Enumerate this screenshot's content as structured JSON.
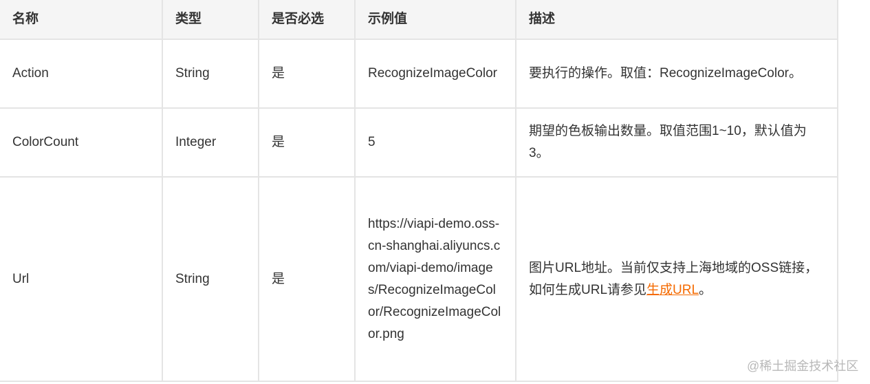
{
  "headers": [
    "名称",
    "类型",
    "是否必选",
    "示例值",
    "描述"
  ],
  "rows": [
    {
      "name": "Action",
      "type": "String",
      "required": "是",
      "example": "RecognizeImageColor",
      "desc": "要执行的操作。取值：RecognizeImageColor。"
    },
    {
      "name": "ColorCount",
      "type": "Integer",
      "required": "是",
      "example": "5",
      "desc": "期望的色板输出数量。取值范围1~10，默认值为3。"
    },
    {
      "name": "Url",
      "type": "String",
      "required": "是",
      "example": "https://viapi-demo.oss-cn-shanghai.aliyuncs.com/viapi-demo/images/RecognizeImageColor/RecognizeImageColor.png",
      "desc_prefix": "图片URL地址。当前仅支持上海地域的OSS链接，如何生成URL请参见",
      "desc_link": "生成URL",
      "desc_suffix": "。"
    }
  ],
  "watermark": "@稀土掘金技术社区",
  "colors": {
    "link": "#f56a00",
    "header_bg": "#f5f5f5",
    "border": "#e4e4e4"
  }
}
